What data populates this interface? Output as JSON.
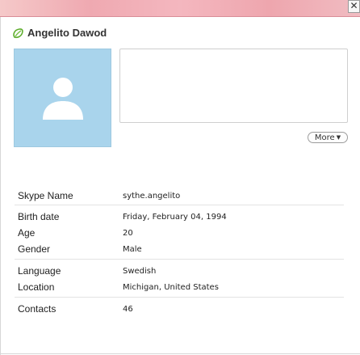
{
  "window": {
    "close_label": "✕"
  },
  "profile": {
    "name": "Angelito Dawod",
    "status_icon": "skype-online-leaf-icon",
    "avatar_icon": "default-avatar-icon",
    "mood_message": "",
    "more_label": "More"
  },
  "details": {
    "skype_name": {
      "label": "Skype Name",
      "value": "sythe.angelito"
    },
    "birth_date": {
      "label": "Birth date",
      "value": "Friday, February 04, 1994"
    },
    "age": {
      "label": "Age",
      "value": "20"
    },
    "gender": {
      "label": "Gender",
      "value": "Male"
    },
    "language": {
      "label": "Language",
      "value": "Swedish"
    },
    "location": {
      "label": "Location",
      "value": "Michigan, United States"
    },
    "contacts": {
      "label": "Contacts",
      "value": "46"
    }
  },
  "colors": {
    "titlebar_accent": "#efa9b1",
    "avatar_bg": "#a9d4ec",
    "status_green": "#7cc04b"
  }
}
